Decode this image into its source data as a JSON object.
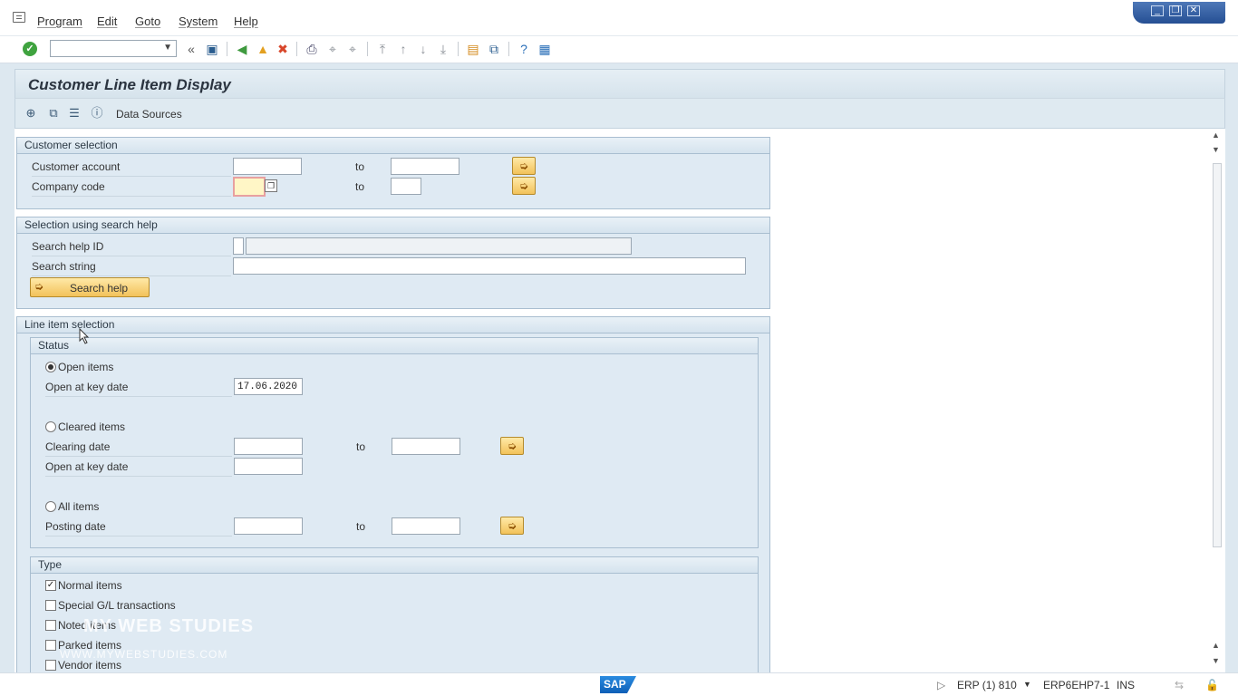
{
  "menu": {
    "items": [
      "Program",
      "Edit",
      "Goto",
      "System",
      "Help"
    ]
  },
  "toolbar": {
    "command_value": "",
    "back_symbol": "«"
  },
  "page": {
    "title": "Customer Line Item Display"
  },
  "app_toolbar": {
    "data_sources_label": "Data Sources"
  },
  "customer_selection": {
    "title": "Customer selection",
    "customer_account_label": "Customer account",
    "customer_account_from": "",
    "customer_account_to": "",
    "company_code_label": "Company code",
    "company_code_from": "",
    "company_code_to": "",
    "to_label": "to"
  },
  "search_help": {
    "title": "Selection using search help",
    "search_help_id_label": "Search help ID",
    "search_help_id_value": "",
    "search_string_label": "Search string",
    "search_string_value": "",
    "button_label": "Search help"
  },
  "line_item_selection": {
    "title": "Line item selection",
    "status": {
      "title": "Status",
      "open_items_label": "Open items",
      "open_at_key_date_label": "Open at key date",
      "open_at_key_date_value": "17.06.2020",
      "cleared_items_label": "Cleared items",
      "clearing_date_label": "Clearing date",
      "clearing_date_from": "",
      "clearing_date_to": "",
      "cleared_open_at_key_date_label": "Open at key date",
      "cleared_open_at_key_date_value": "",
      "all_items_label": "All items",
      "posting_date_label": "Posting date",
      "posting_date_from": "",
      "posting_date_to": "",
      "selected": "open_items"
    },
    "type": {
      "title": "Type",
      "items": [
        {
          "label": "Normal items",
          "checked": true
        },
        {
          "label": "Special G/L transactions",
          "checked": false
        },
        {
          "label": "Noted items",
          "checked": false
        },
        {
          "label": "Parked items",
          "checked": false
        },
        {
          "label": "Vendor items",
          "checked": false
        }
      ]
    }
  },
  "status_bar": {
    "system": "ERP (1) 810",
    "server": "ERP6EHP7-1",
    "mode": "INS",
    "logo": "SAP"
  },
  "watermark": {
    "line1": "MY WEB STUDIES",
    "line2": "WWW.MYWEBSTUDIES.COM"
  }
}
